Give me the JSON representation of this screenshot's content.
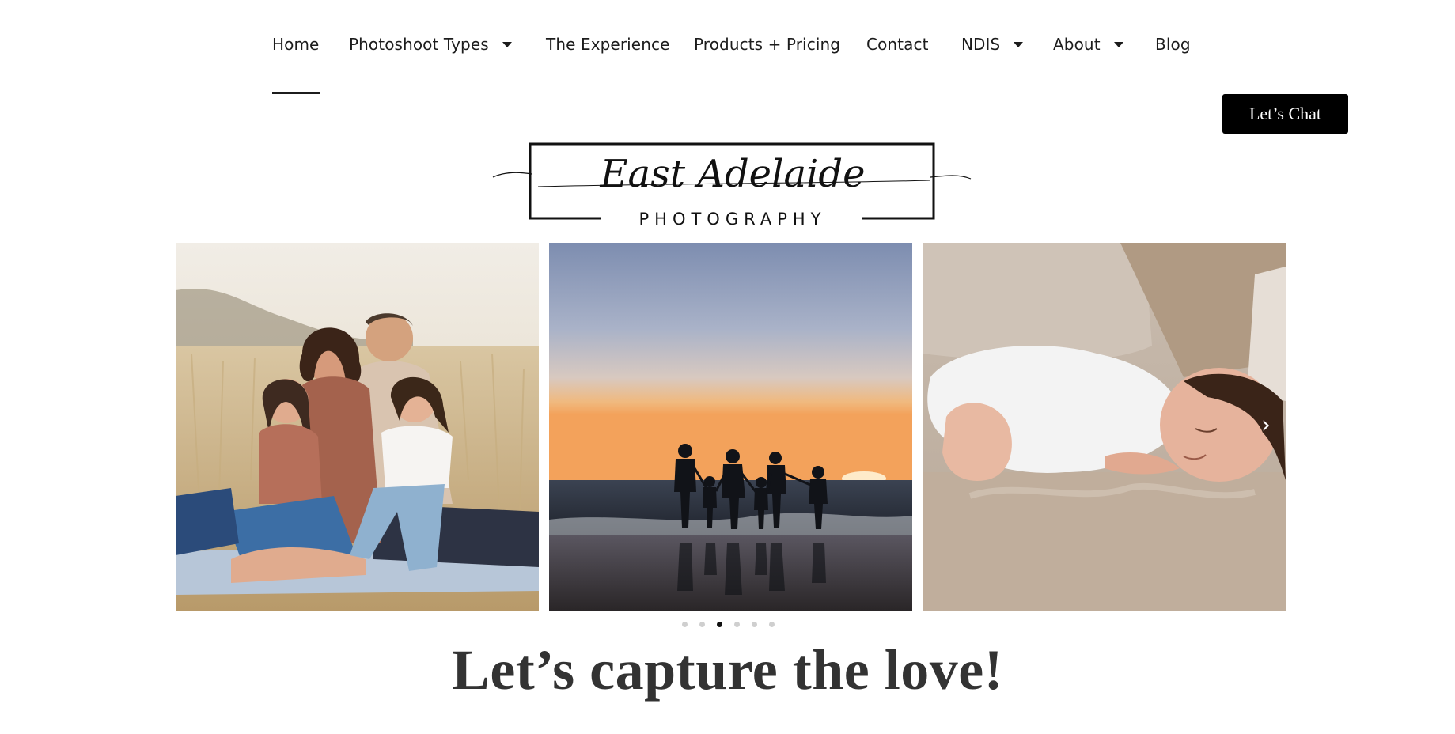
{
  "nav": {
    "items": [
      {
        "label": "Home",
        "has_dropdown": false,
        "active": true
      },
      {
        "label": "Photoshoot Types",
        "has_dropdown": true
      },
      {
        "label": "The Experience",
        "has_dropdown": false
      },
      {
        "label": "Products + Pricing",
        "has_dropdown": false
      },
      {
        "label": "Contact",
        "has_dropdown": false
      },
      {
        "label": "NDIS",
        "has_dropdown": true
      },
      {
        "label": "About",
        "has_dropdown": true
      },
      {
        "label": "Blog",
        "has_dropdown": false
      }
    ],
    "cta_label": "Let’s Chat"
  },
  "logo": {
    "script_text": "East Adelaide",
    "sub_text": "PHOTOGRAPHY"
  },
  "carousel": {
    "slides": [
      {
        "subject": "family-in-field"
      },
      {
        "subject": "family-beach-sunset-silhouette"
      },
      {
        "subject": "sleeping-newborn"
      }
    ],
    "next_icon": "chevron-right-icon",
    "prev_icon": "chevron-left-icon",
    "dot_count": 6,
    "active_dot": 3
  },
  "headline": "Let’s capture the love!",
  "colors": {
    "cta_background": "#000000",
    "headline": "#333333",
    "active_dot": "#111111"
  }
}
